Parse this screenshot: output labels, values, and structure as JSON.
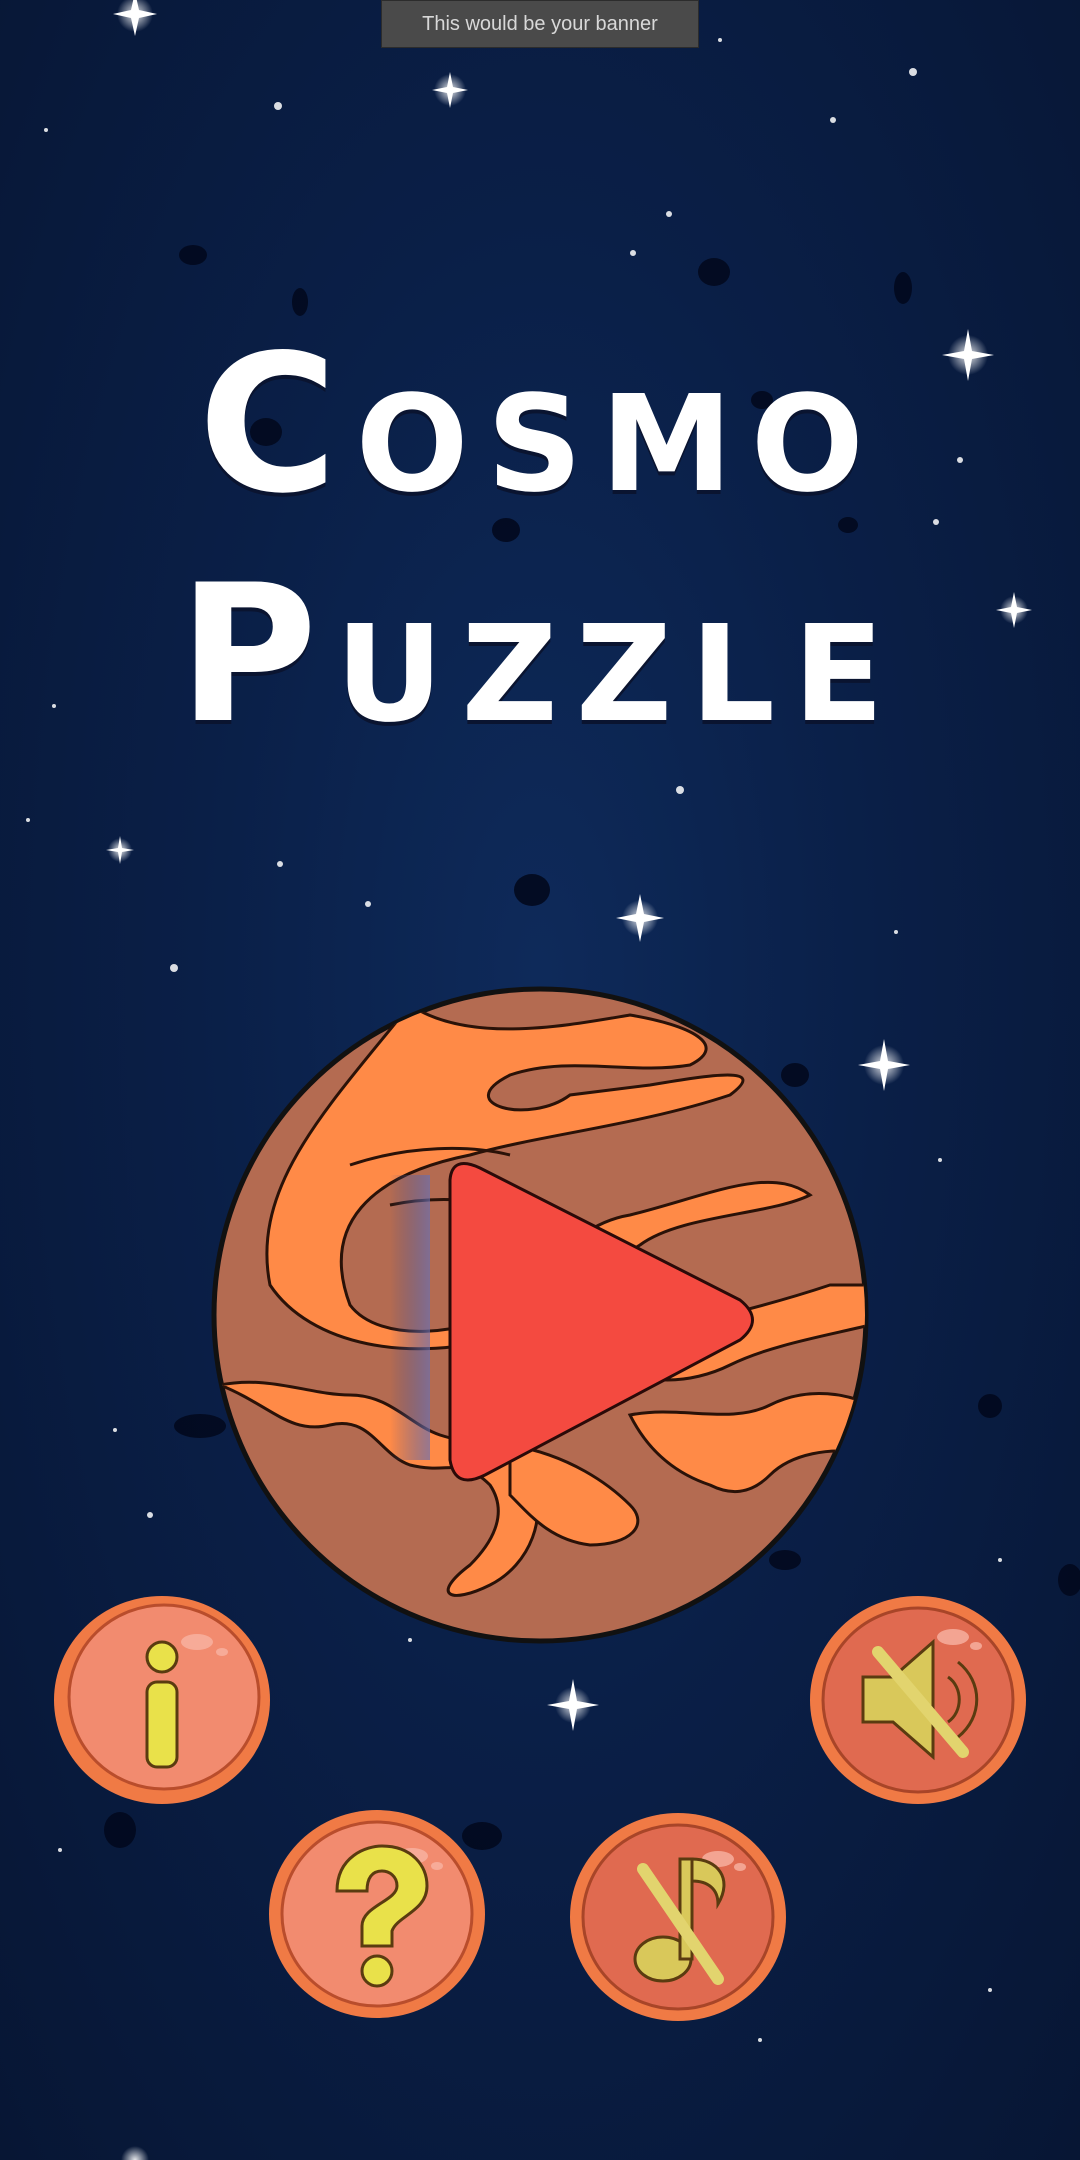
{
  "banner": {
    "text": "This would be your banner"
  },
  "title": {
    "line1": "Cosmo",
    "line2": "Puzzle"
  },
  "buttons": {
    "play": {
      "icon": "play-icon",
      "color": "#f44a40"
    },
    "info": {
      "icon": "info-icon",
      "label": "i"
    },
    "help": {
      "icon": "question-icon",
      "label": "?"
    },
    "music": {
      "icon": "music-off-icon",
      "muted": true
    },
    "sound": {
      "icon": "speaker-mute-icon",
      "muted": true
    }
  },
  "colors": {
    "background": "#0a1f47",
    "planet_base": "#b46b51",
    "planet_bands": "#ff8a47",
    "button_rim": "#f07a45",
    "button_face": "#f28b6f",
    "icon_yellow": "#e9e14a"
  }
}
